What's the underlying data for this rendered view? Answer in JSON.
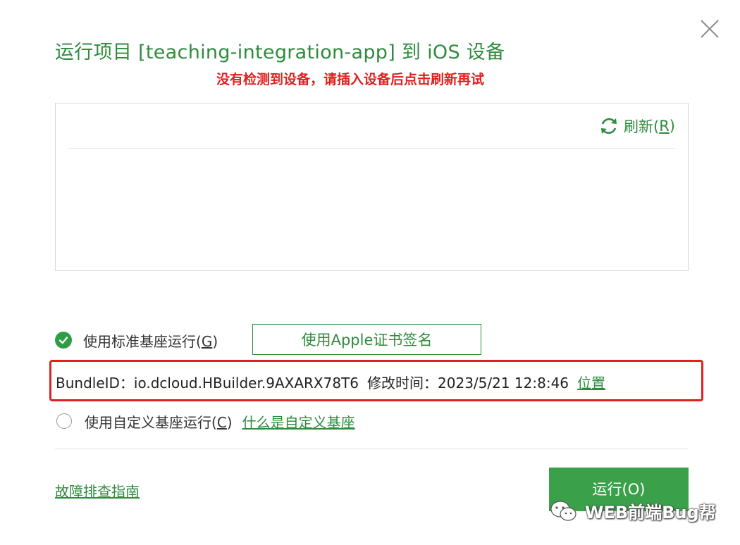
{
  "dialog": {
    "title": "运行项目 [teaching-integration-app] 到 iOS 设备",
    "warning": "没有检测到设备，请插入设备后点击刷新再试"
  },
  "device_list": {
    "refresh_label": "刷新(",
    "refresh_key": "R",
    "refresh_suffix": ")",
    "devices": []
  },
  "options": {
    "standard_base": {
      "label": "使用标准基座运行(",
      "key": "G",
      "suffix": ")",
      "checked": true,
      "sign_button": "使用Apple证书签名"
    },
    "bundle": {
      "text": "BundleID：io.dcloud.HBuilder.9AXARX78T6",
      "modified": "修改时间：2023/5/21 12:8:46",
      "location_link": "位置"
    },
    "custom_base": {
      "label": "使用自定义基座运行(",
      "key": "C",
      "suffix": ")",
      "checked": false,
      "help_link": "什么是自定义基座"
    }
  },
  "footer": {
    "guide_link": "故障排查指南",
    "run_button": "运行(O)"
  },
  "watermark": {
    "text": "WEB前端Bug帮"
  },
  "colors": {
    "accent": "#2e8b3e",
    "warning": "#e02020",
    "run_button": "#3aa14a",
    "highlight_border": "#e02020"
  },
  "icons": [
    "close-icon",
    "refresh-icon",
    "check-circle-icon",
    "radio-empty-icon",
    "wechat-icon"
  ]
}
